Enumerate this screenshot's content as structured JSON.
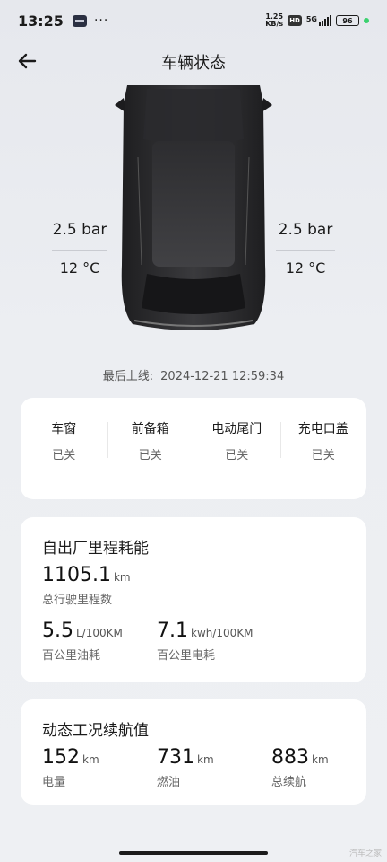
{
  "status_bar": {
    "time": "13:25",
    "dots": "···",
    "net_speed_value": "1.25",
    "net_speed_unit": "KB/s",
    "hd": "HD",
    "network": "5G",
    "battery": "96"
  },
  "header": {
    "title": "车辆状态",
    "back_icon": "back-arrow-icon"
  },
  "tires": {
    "left": {
      "pressure": "2.5 bar",
      "temperature": "12 °C"
    },
    "right": {
      "pressure": "2.5 bar",
      "temperature": "12 °C"
    }
  },
  "last_online": {
    "label": "最后上线:",
    "value": "2024-12-21 12:59:34"
  },
  "vehicle_status": [
    {
      "label": "车窗",
      "value": "已关"
    },
    {
      "label": "前备箱",
      "value": "已关"
    },
    {
      "label": "电动尾门",
      "value": "已关"
    },
    {
      "label": "充电口盖",
      "value": "已关"
    }
  ],
  "mileage": {
    "title": "自出厂里程耗能",
    "total": {
      "value": "1105.1",
      "unit": "km",
      "label": "总行驶里程数"
    },
    "fuel": {
      "value": "5.5",
      "unit": "L/100KM",
      "label": "百公里油耗"
    },
    "electric": {
      "value": "7.1",
      "unit": "kwh/100KM",
      "label": "百公里电耗"
    }
  },
  "range": {
    "title": "动态工况续航值",
    "items": [
      {
        "value": "152",
        "unit": "km",
        "label": "电量"
      },
      {
        "value": "731",
        "unit": "km",
        "label": "燃油"
      },
      {
        "value": "883",
        "unit": "km",
        "label": "总续航"
      }
    ]
  },
  "watermark": "汽车之家",
  "colors": {
    "background": "#eceef2",
    "card": "#ffffff",
    "car_body": "#2a2a2c",
    "status_green": "#3bd16f"
  }
}
